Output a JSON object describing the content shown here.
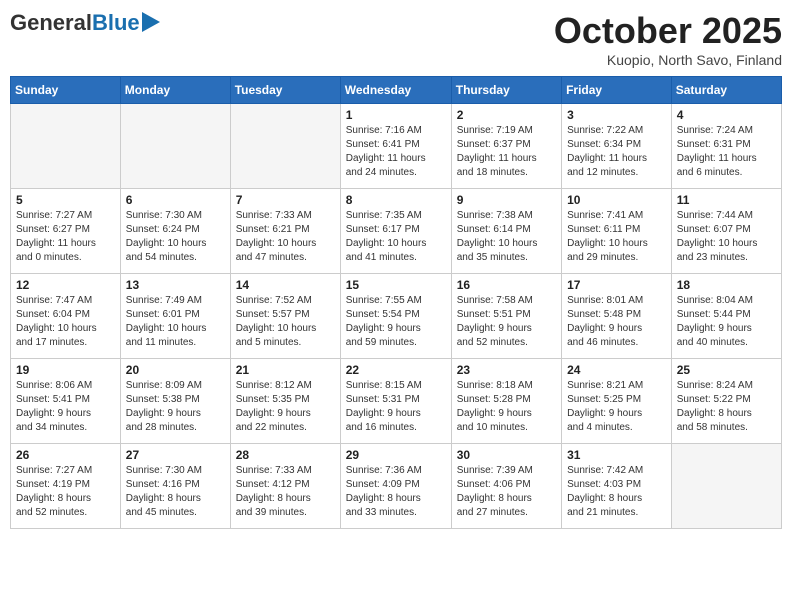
{
  "header": {
    "logo_general": "General",
    "logo_blue": "Blue",
    "month_title": "October 2025",
    "location": "Kuopio, North Savo, Finland"
  },
  "weekdays": [
    "Sunday",
    "Monday",
    "Tuesday",
    "Wednesday",
    "Thursday",
    "Friday",
    "Saturday"
  ],
  "weeks": [
    [
      {
        "day": "",
        "info": ""
      },
      {
        "day": "",
        "info": ""
      },
      {
        "day": "",
        "info": ""
      },
      {
        "day": "1",
        "info": "Sunrise: 7:16 AM\nSunset: 6:41 PM\nDaylight: 11 hours\nand 24 minutes."
      },
      {
        "day": "2",
        "info": "Sunrise: 7:19 AM\nSunset: 6:37 PM\nDaylight: 11 hours\nand 18 minutes."
      },
      {
        "day": "3",
        "info": "Sunrise: 7:22 AM\nSunset: 6:34 PM\nDaylight: 11 hours\nand 12 minutes."
      },
      {
        "day": "4",
        "info": "Sunrise: 7:24 AM\nSunset: 6:31 PM\nDaylight: 11 hours\nand 6 minutes."
      }
    ],
    [
      {
        "day": "5",
        "info": "Sunrise: 7:27 AM\nSunset: 6:27 PM\nDaylight: 11 hours\nand 0 minutes."
      },
      {
        "day": "6",
        "info": "Sunrise: 7:30 AM\nSunset: 6:24 PM\nDaylight: 10 hours\nand 54 minutes."
      },
      {
        "day": "7",
        "info": "Sunrise: 7:33 AM\nSunset: 6:21 PM\nDaylight: 10 hours\nand 47 minutes."
      },
      {
        "day": "8",
        "info": "Sunrise: 7:35 AM\nSunset: 6:17 PM\nDaylight: 10 hours\nand 41 minutes."
      },
      {
        "day": "9",
        "info": "Sunrise: 7:38 AM\nSunset: 6:14 PM\nDaylight: 10 hours\nand 35 minutes."
      },
      {
        "day": "10",
        "info": "Sunrise: 7:41 AM\nSunset: 6:11 PM\nDaylight: 10 hours\nand 29 minutes."
      },
      {
        "day": "11",
        "info": "Sunrise: 7:44 AM\nSunset: 6:07 PM\nDaylight: 10 hours\nand 23 minutes."
      }
    ],
    [
      {
        "day": "12",
        "info": "Sunrise: 7:47 AM\nSunset: 6:04 PM\nDaylight: 10 hours\nand 17 minutes."
      },
      {
        "day": "13",
        "info": "Sunrise: 7:49 AM\nSunset: 6:01 PM\nDaylight: 10 hours\nand 11 minutes."
      },
      {
        "day": "14",
        "info": "Sunrise: 7:52 AM\nSunset: 5:57 PM\nDaylight: 10 hours\nand 5 minutes."
      },
      {
        "day": "15",
        "info": "Sunrise: 7:55 AM\nSunset: 5:54 PM\nDaylight: 9 hours\nand 59 minutes."
      },
      {
        "day": "16",
        "info": "Sunrise: 7:58 AM\nSunset: 5:51 PM\nDaylight: 9 hours\nand 52 minutes."
      },
      {
        "day": "17",
        "info": "Sunrise: 8:01 AM\nSunset: 5:48 PM\nDaylight: 9 hours\nand 46 minutes."
      },
      {
        "day": "18",
        "info": "Sunrise: 8:04 AM\nSunset: 5:44 PM\nDaylight: 9 hours\nand 40 minutes."
      }
    ],
    [
      {
        "day": "19",
        "info": "Sunrise: 8:06 AM\nSunset: 5:41 PM\nDaylight: 9 hours\nand 34 minutes."
      },
      {
        "day": "20",
        "info": "Sunrise: 8:09 AM\nSunset: 5:38 PM\nDaylight: 9 hours\nand 28 minutes."
      },
      {
        "day": "21",
        "info": "Sunrise: 8:12 AM\nSunset: 5:35 PM\nDaylight: 9 hours\nand 22 minutes."
      },
      {
        "day": "22",
        "info": "Sunrise: 8:15 AM\nSunset: 5:31 PM\nDaylight: 9 hours\nand 16 minutes."
      },
      {
        "day": "23",
        "info": "Sunrise: 8:18 AM\nSunset: 5:28 PM\nDaylight: 9 hours\nand 10 minutes."
      },
      {
        "day": "24",
        "info": "Sunrise: 8:21 AM\nSunset: 5:25 PM\nDaylight: 9 hours\nand 4 minutes."
      },
      {
        "day": "25",
        "info": "Sunrise: 8:24 AM\nSunset: 5:22 PM\nDaylight: 8 hours\nand 58 minutes."
      }
    ],
    [
      {
        "day": "26",
        "info": "Sunrise: 7:27 AM\nSunset: 4:19 PM\nDaylight: 8 hours\nand 52 minutes."
      },
      {
        "day": "27",
        "info": "Sunrise: 7:30 AM\nSunset: 4:16 PM\nDaylight: 8 hours\nand 45 minutes."
      },
      {
        "day": "28",
        "info": "Sunrise: 7:33 AM\nSunset: 4:12 PM\nDaylight: 8 hours\nand 39 minutes."
      },
      {
        "day": "29",
        "info": "Sunrise: 7:36 AM\nSunset: 4:09 PM\nDaylight: 8 hours\nand 33 minutes."
      },
      {
        "day": "30",
        "info": "Sunrise: 7:39 AM\nSunset: 4:06 PM\nDaylight: 8 hours\nand 27 minutes."
      },
      {
        "day": "31",
        "info": "Sunrise: 7:42 AM\nSunset: 4:03 PM\nDaylight: 8 hours\nand 21 minutes."
      },
      {
        "day": "",
        "info": ""
      }
    ]
  ]
}
